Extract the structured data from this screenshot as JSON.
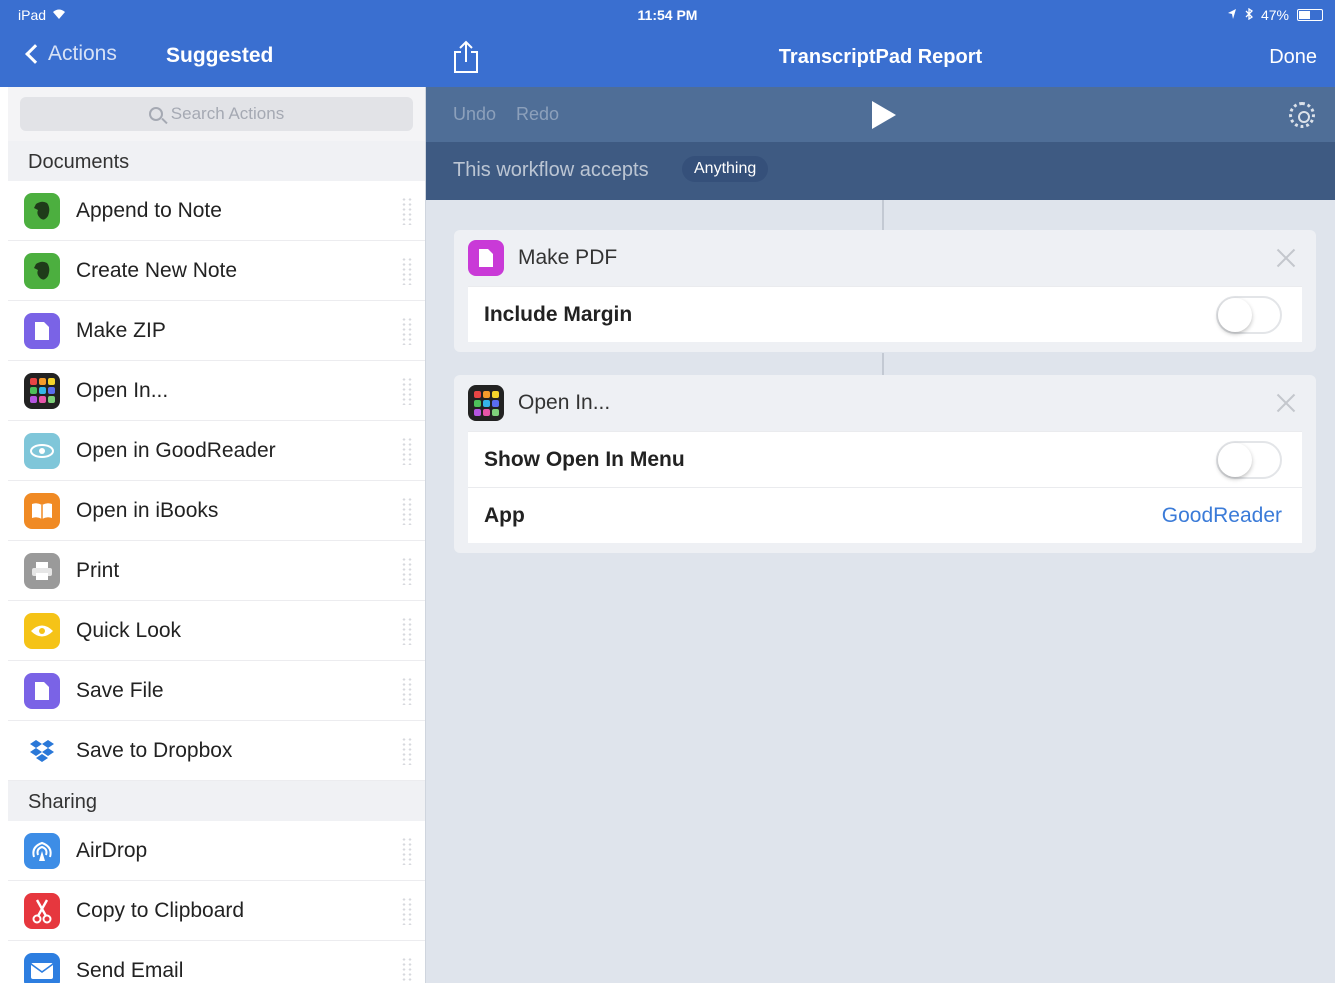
{
  "status": {
    "device": "iPad",
    "time": "11:54 PM",
    "battery": "47%"
  },
  "nav": {
    "back_label": "Actions",
    "left_title": "Suggested",
    "title": "TranscriptPad Report",
    "done_label": "Done"
  },
  "search": {
    "placeholder": "Search Actions"
  },
  "sections": {
    "documents": "Documents",
    "sharing": "Sharing"
  },
  "documents_items": [
    {
      "label": "Append to Note",
      "icon": "evernote-icon"
    },
    {
      "label": "Create New Note",
      "icon": "evernote-icon"
    },
    {
      "label": "Make ZIP",
      "icon": "document-icon"
    },
    {
      "label": "Open In...",
      "icon": "app-grid-icon"
    },
    {
      "label": "Open in GoodReader",
      "icon": "goodreader-icon"
    },
    {
      "label": "Open in iBooks",
      "icon": "ibooks-icon"
    },
    {
      "label": "Print",
      "icon": "printer-icon"
    },
    {
      "label": "Quick Look",
      "icon": "eye-icon"
    },
    {
      "label": "Save File",
      "icon": "document-icon"
    },
    {
      "label": "Save to Dropbox",
      "icon": "dropbox-icon"
    }
  ],
  "sharing_items": [
    {
      "label": "AirDrop",
      "icon": "airdrop-icon"
    },
    {
      "label": "Copy to Clipboard",
      "icon": "scissors-icon"
    },
    {
      "label": "Send Email",
      "icon": "mail-icon"
    }
  ],
  "toolbar": {
    "undo": "Undo",
    "redo": "Redo",
    "accepts_label": "This workflow accepts",
    "accepts_value": "Anything"
  },
  "cards": {
    "make_pdf": {
      "title": "Make PDF",
      "row_label": "Include Margin"
    },
    "open_in": {
      "title": "Open In...",
      "row1_label": "Show Open In Menu",
      "row2_label": "App",
      "row2_value": "GoodReader"
    }
  },
  "colors": {
    "nav_blue": "#3a6fd0",
    "toolbar": "#4f6e97",
    "accepts_bar": "#3e5a82",
    "link": "#3b7bd8"
  }
}
